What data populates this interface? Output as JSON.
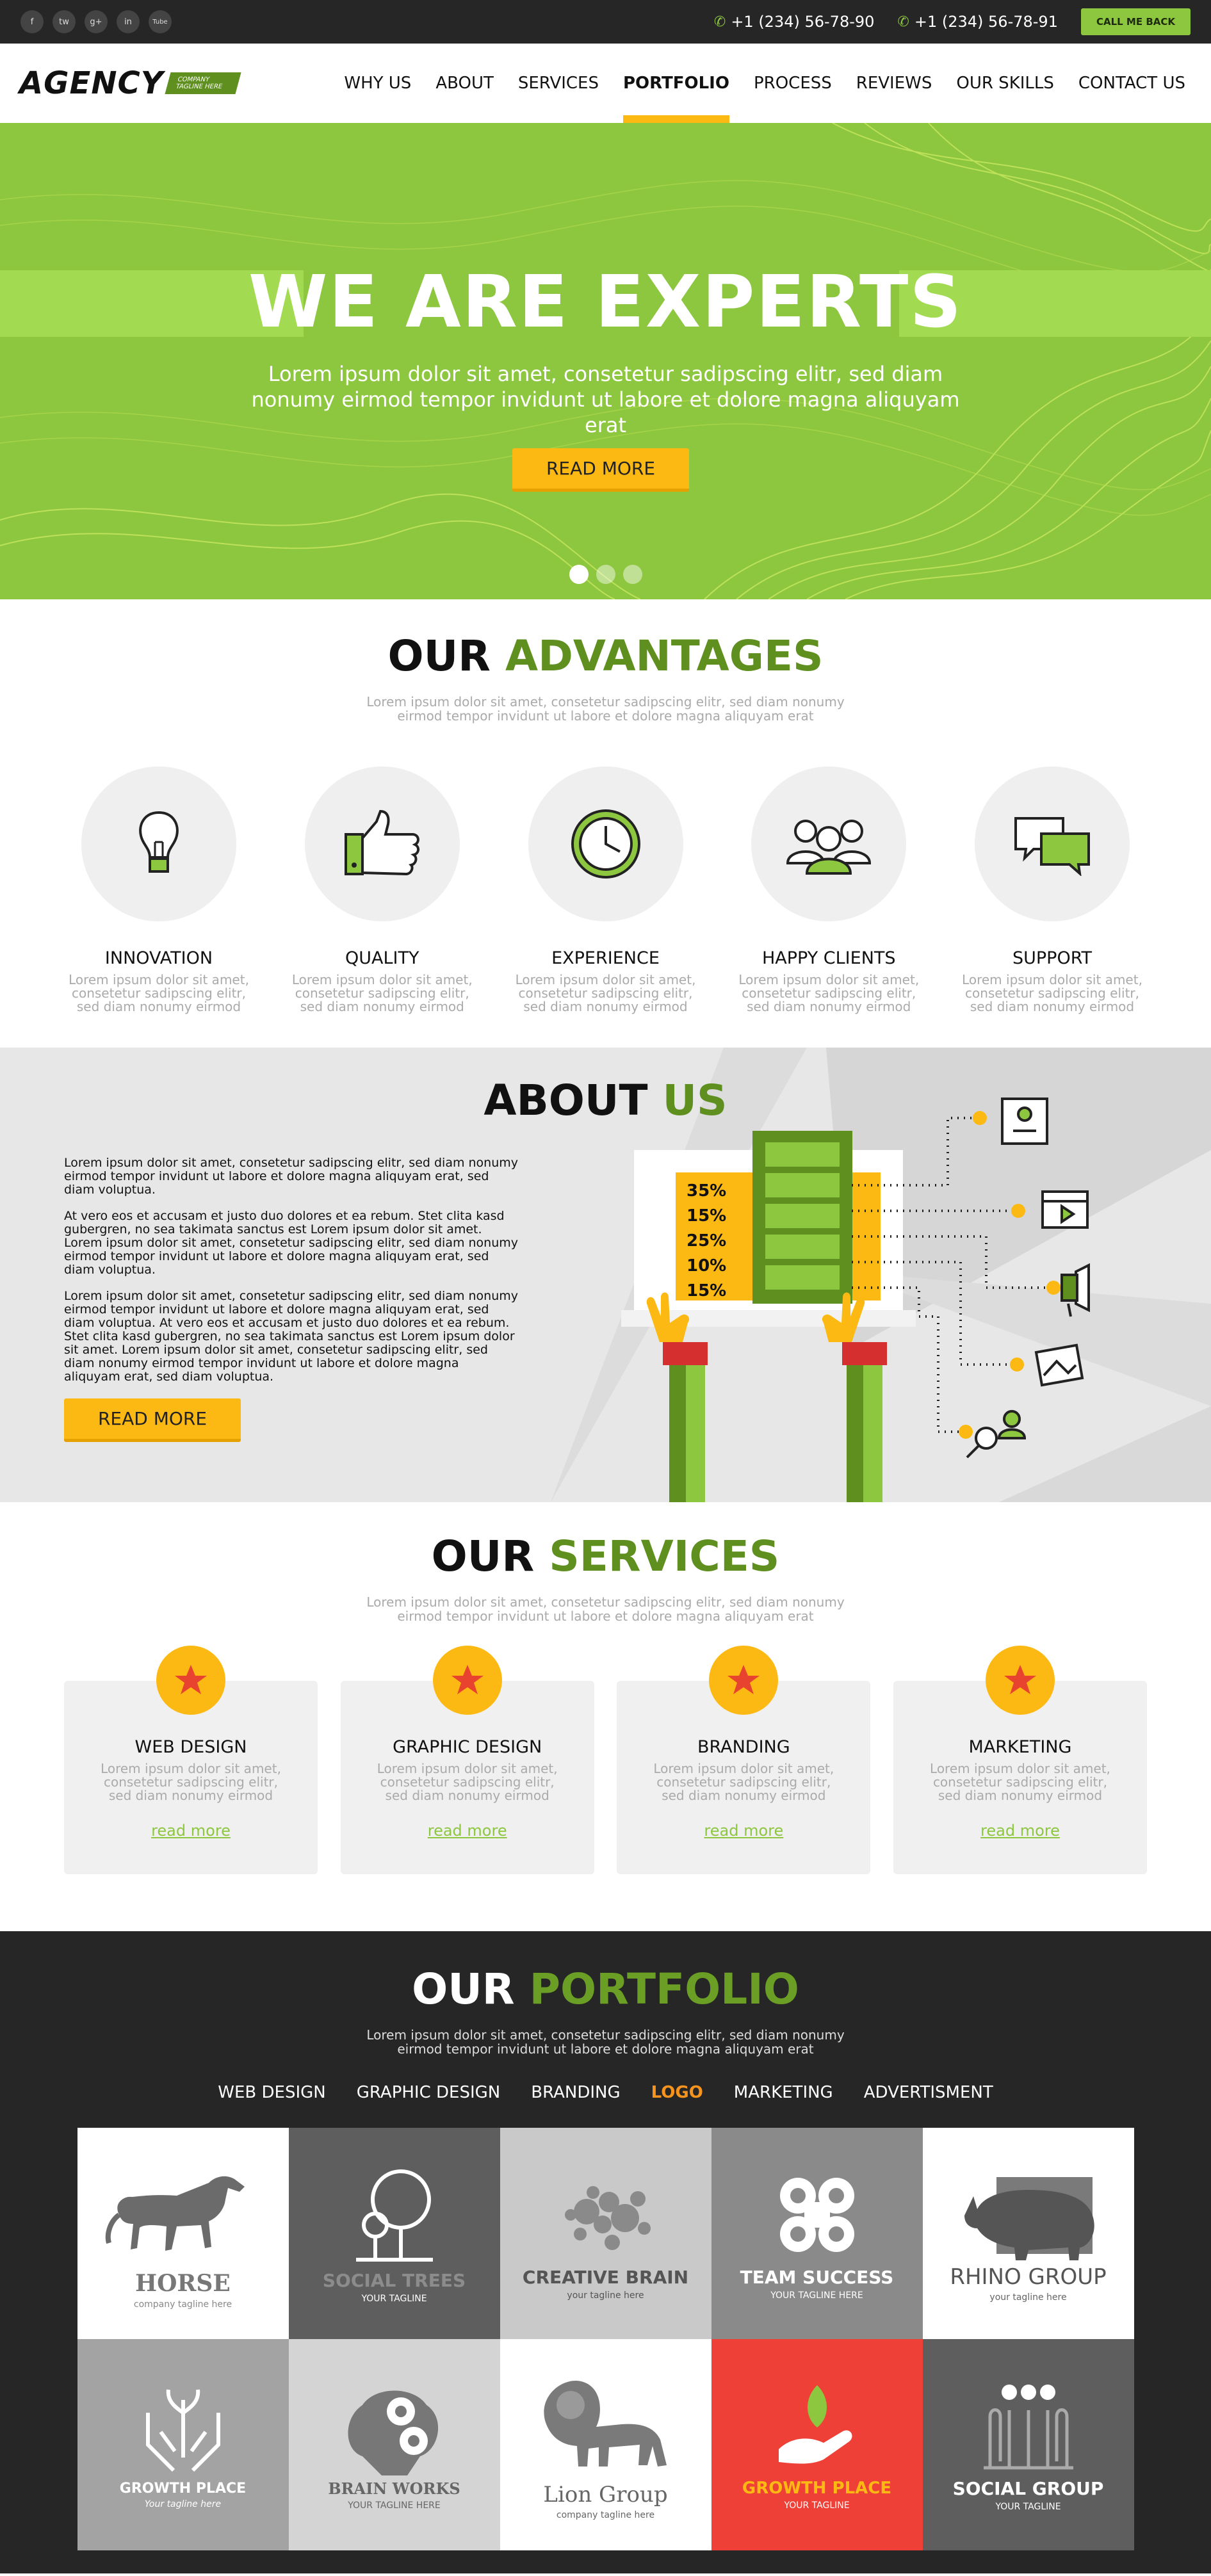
{
  "topbar": {
    "socials": [
      "f",
      "tw",
      "g+",
      "in",
      "Tube"
    ],
    "phones": [
      "+1 (234) 56-78-90",
      "+1 (234) 56-78-91"
    ],
    "call_button": "CALL ME BACK"
  },
  "header": {
    "logo": "AGENCY",
    "logo_tag_1": "COMPANY",
    "logo_tag_2": "TAGLINE HERE",
    "nav": [
      "WHY US",
      "ABOUT",
      "SERVICES",
      "PORTFOLIO",
      "PROCESS",
      "REVIEWS",
      "OUR SKILLS",
      "CONTACT US"
    ],
    "active": "PORTFOLIO"
  },
  "hero": {
    "title": "WE ARE EXPERTS",
    "subtitle": "Lorem ipsum dolor sit amet, consetetur sadipscing elitr, sed diam nonumy eirmod tempor invidunt ut labore et dolore magna aliquyam erat",
    "button": "READ MORE",
    "slides": 3,
    "active_slide": 1
  },
  "advantages": {
    "title_a": "OUR",
    "title_b": "ADVANTAGES",
    "subtitle": "Lorem ipsum dolor sit amet, consetetur sadipscing elitr, sed diam nonumy eirmod tempor invidunt ut labore et dolore magna aliquyam erat",
    "items": [
      {
        "name": "INNOVATION",
        "icon": "lightbulb-icon",
        "desc": "Lorem ipsum dolor sit amet, consetetur sadipscing elitr, sed diam nonumy eirmod"
      },
      {
        "name": "QUALITY",
        "icon": "thumbs-up-icon",
        "desc": "Lorem ipsum dolor sit amet, consetetur sadipscing elitr, sed diam nonumy eirmod"
      },
      {
        "name": "EXPERIENCE",
        "icon": "clock-icon",
        "desc": "Lorem ipsum dolor sit amet, consetetur sadipscing elitr, sed diam nonumy eirmod"
      },
      {
        "name": "HAPPY CLIENTS",
        "icon": "people-icon",
        "desc": "Lorem ipsum dolor sit amet, consetetur sadipscing elitr, sed diam nonumy eirmod"
      },
      {
        "name": "SUPPORT",
        "icon": "chat-icon",
        "desc": "Lorem ipsum dolor sit amet, consetetur sadipscing elitr, sed diam nonumy eirmod"
      }
    ]
  },
  "about": {
    "title_a": "ABOUT",
    "title_b": "US",
    "paragraphs": [
      "Lorem ipsum dolor sit amet, consetetur sadipscing elitr, sed diam nonumy eirmod tempor invidunt ut labore et dolore magna aliquyam erat, sed diam voluptua.",
      "At vero eos et accusam et justo duo dolores et ea rebum. Stet clita kasd gubergren, no sea takimata sanctus est Lorem ipsum dolor sit amet. Lorem ipsum dolor sit amet, consetetur sadipscing elitr, sed diam nonumy eirmod tempor invidunt ut labore et dolore magna aliquyam erat, sed diam voluptua.",
      "Lorem ipsum dolor sit amet, consetetur sadipscing elitr, sed diam nonumy eirmod tempor invidunt ut labore et dolore magna aliquyam erat, sed diam voluptua. At vero eos et accusam et justo duo dolores et ea rebum. Stet clita kasd gubergren, no sea takimata sanctus est Lorem ipsum dolor sit amet. Lorem ipsum dolor sit amet, consetetur sadipscing elitr, sed diam nonumy eirmod tempor invidunt ut labore et dolore magna aliquyam erat, sed diam voluptua."
    ],
    "button": "READ MORE",
    "percentages": [
      "35%",
      "15%",
      "25%",
      "10%",
      "15%"
    ]
  },
  "services": {
    "title_a": "OUR",
    "title_b": "SERVICES",
    "subtitle": "Lorem ipsum dolor sit amet, consetetur sadipscing elitr, sed diam nonumy eirmod tempor invidunt ut labore et dolore magna aliquyam erat",
    "items": [
      {
        "name": "WEB DESIGN",
        "desc": "Lorem ipsum dolor sit amet, consetetur sadipscing elitr, sed diam nonumy eirmod",
        "link": "read more"
      },
      {
        "name": "GRAPHIC DESIGN",
        "desc": "Lorem ipsum dolor sit amet, consetetur sadipscing elitr, sed diam nonumy eirmod",
        "link": "read more"
      },
      {
        "name": "BRANDING",
        "desc": "Lorem ipsum dolor sit amet, consetetur sadipscing elitr, sed diam nonumy eirmod",
        "link": "read more"
      },
      {
        "name": "MARKETING",
        "desc": "Lorem ipsum dolor sit amet, consetetur sadipscing elitr, sed diam nonumy eirmod",
        "link": "read more"
      }
    ]
  },
  "portfolio": {
    "title_a": "OUR",
    "title_b": "PORTFOLIO",
    "subtitle": "Lorem ipsum dolor sit amet, consetetur sadipscing elitr, sed diam nonumy eirmod tempor invidunt ut labore et dolore magna aliquyam erat",
    "tabs": [
      "WEB DESIGN",
      "GRAPHIC DESIGN",
      "BRANDING",
      "LOGO",
      "MARKETING",
      "ADVERTISMENT"
    ],
    "active_tab": "LOGO",
    "tiles": [
      {
        "brand": "HORSE",
        "tagline": "company tagline here",
        "bg": "#ffffff",
        "fg": "#666666"
      },
      {
        "brand": "SOCIAL TREES",
        "tagline": "YOUR TAGLINE",
        "bg": "#5e5e5e",
        "fg": "#8c8c8c"
      },
      {
        "brand": "CREATIVE BRAIN",
        "tagline": "your tagline here",
        "bg": "#c9c9c9",
        "fg": "#555555"
      },
      {
        "brand": "TEAM SUCCESS",
        "tagline": "YOUR TAGLINE HERE",
        "bg": "#8a8a8a",
        "fg": "#ffffff"
      },
      {
        "brand": "RHINO GROUP",
        "tagline": "your tagline here",
        "bg": "#ffffff",
        "fg": "#555555"
      },
      {
        "brand": "GROWTH PLACE",
        "tagline": "Your tagline here",
        "bg": "#a3a3a3",
        "fg": "#ffffff"
      },
      {
        "brand": "BRAIN WORKS",
        "tagline": "YOUR TAGLINE HERE",
        "bg": "#d4d4d4",
        "fg": "#666666"
      },
      {
        "brand": "Lion Group",
        "tagline": "company tagline here",
        "bg": "#ffffff",
        "fg": "#666666"
      },
      {
        "brand": "GROWTH PLACE",
        "tagline": "YOUR TAGLINE",
        "bg": "#ee4036",
        "fg": "#ffffff"
      },
      {
        "brand": "SOCIAL GROUP",
        "tagline": "YOUR TAGLINE",
        "bg": "#5e5e5e",
        "fg": "#ffffff"
      }
    ]
  },
  "colors": {
    "green": "#8dc63f",
    "dark_green": "#5e8f1f",
    "yellow": "#fdb913",
    "orange": "#f7941d",
    "dark": "#262626"
  }
}
